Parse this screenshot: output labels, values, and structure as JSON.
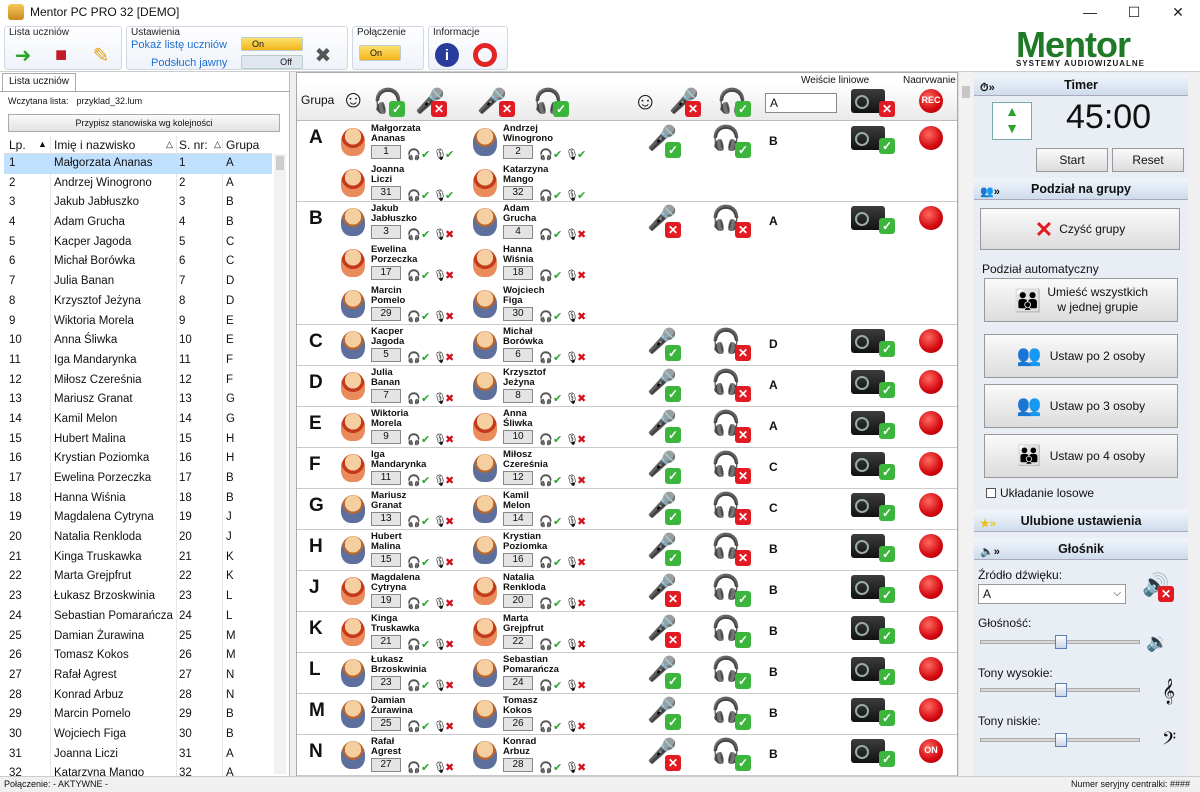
{
  "window": {
    "title": "Mentor PC PRO 32 [DEMO]"
  },
  "ribbon": {
    "group1_label": "Lista uczniów",
    "group2_label": "Ustawienia",
    "show_list_label": "Pokaż listę uczniów",
    "show_list_state": "On",
    "listen_label": "Podsłuch jawny",
    "listen_state": "Off",
    "group3_label": "Połączenie",
    "conn_state": "On",
    "group4_label": "Informacje",
    "logo_text": "Mentor",
    "logo_sub": "SYSTEMY AUDIOWIZUALNE"
  },
  "left": {
    "tab": "Lista uczniów",
    "loaded_label": "Wczytana lista:",
    "loaded_file": "przyklad_32.lum",
    "sort_button": "Przypisz stanowiska wg kolejności",
    "headers": [
      "Lp.",
      "Imię i nazwisko",
      "S. nr:",
      "Grupa"
    ],
    "rows": [
      [
        "1",
        "Małgorzata Ananas",
        "1",
        "A"
      ],
      [
        "2",
        "Andrzej Winogrono",
        "2",
        "A"
      ],
      [
        "3",
        "Jakub Jabłuszko",
        "3",
        "B"
      ],
      [
        "4",
        "Adam Grucha",
        "4",
        "B"
      ],
      [
        "5",
        "Kacper Jagoda",
        "5",
        "C"
      ],
      [
        "6",
        "Michał Borówka",
        "6",
        "C"
      ],
      [
        "7",
        "Julia Banan",
        "7",
        "D"
      ],
      [
        "8",
        "Krzysztof Jeżyna",
        "8",
        "D"
      ],
      [
        "9",
        "Wiktoria Morela",
        "9",
        "E"
      ],
      [
        "10",
        "Anna Śliwka",
        "10",
        "E"
      ],
      [
        "11",
        "Iga Mandarynka",
        "11",
        "F"
      ],
      [
        "12",
        "Miłosz Czereśnia",
        "12",
        "F"
      ],
      [
        "13",
        "Mariusz Granat",
        "13",
        "G"
      ],
      [
        "14",
        "Kamil Melon",
        "14",
        "G"
      ],
      [
        "15",
        "Hubert Malina",
        "15",
        "H"
      ],
      [
        "16",
        "Krystian Poziomka",
        "16",
        "H"
      ],
      [
        "17",
        "Ewelina Porzeczka",
        "17",
        "B"
      ],
      [
        "18",
        "Hanna Wiśnia",
        "18",
        "B"
      ],
      [
        "19",
        "Magdalena Cytryna",
        "19",
        "J"
      ],
      [
        "20",
        "Natalia Renkloda",
        "20",
        "J"
      ],
      [
        "21",
        "Kinga Truskawka",
        "21",
        "K"
      ],
      [
        "22",
        "Marta Grejpfrut",
        "22",
        "K"
      ],
      [
        "23",
        "Łukasz Brzoskwinia",
        "23",
        "L"
      ],
      [
        "24",
        "Sebastian Pomarańcza",
        "24",
        "L"
      ],
      [
        "25",
        "Damian Żurawina",
        "25",
        "M"
      ],
      [
        "26",
        "Tomasz Kokos",
        "26",
        "M"
      ],
      [
        "27",
        "Rafał Agrest",
        "27",
        "N"
      ],
      [
        "28",
        "Konrad Arbuz",
        "28",
        "N"
      ],
      [
        "29",
        "Marcin Pomelo",
        "29",
        "B"
      ],
      [
        "30",
        "Wojciech Figa",
        "30",
        "B"
      ],
      [
        "31",
        "Joanna Liczi",
        "31",
        "A"
      ],
      [
        "32",
        "Katarzyna Mango",
        "32",
        "A"
      ]
    ]
  },
  "center": {
    "group_label": "Grupa",
    "line_in_label": "Wejście liniowe",
    "recording_label": "Nagrywanie",
    "header_source": "A",
    "header_rec": "REC",
    "groups": [
      {
        "letter": "A",
        "src": "B",
        "rec": "",
        "students": [
          [
            "Małgorzata",
            "Ananas",
            "1",
            "girl"
          ],
          [
            "Andrzej",
            "Winogrono",
            "2",
            "boy"
          ],
          [
            "Joanna",
            "Liczi",
            "31",
            "girl"
          ],
          [
            "Katarzyna",
            "Mango",
            "32",
            "girl"
          ]
        ]
      },
      {
        "letter": "B",
        "src": "A",
        "rec": "",
        "students": [
          [
            "Jakub",
            "Jabłuszko",
            "3",
            "boy"
          ],
          [
            "Adam",
            "Grucha",
            "4",
            "boy"
          ],
          [
            "Ewelina",
            "Porzeczka",
            "17",
            "girl"
          ],
          [
            "Hanna",
            "Wiśnia",
            "18",
            "girl"
          ],
          [
            "Marcin",
            "Pomelo",
            "29",
            "boy"
          ],
          [
            "Wojciech",
            "Figa",
            "30",
            "boy"
          ]
        ]
      },
      {
        "letter": "C",
        "src": "D",
        "rec": "",
        "students": [
          [
            "Kacper",
            "Jagoda",
            "5",
            "boy"
          ],
          [
            "Michał",
            "Borówka",
            "6",
            "boy"
          ]
        ]
      },
      {
        "letter": "D",
        "src": "A",
        "rec": "",
        "students": [
          [
            "Julia",
            "Banan",
            "7",
            "girl"
          ],
          [
            "Krzysztof",
            "Jeżyna",
            "8",
            "boy"
          ]
        ]
      },
      {
        "letter": "E",
        "src": "A",
        "rec": "",
        "students": [
          [
            "Wiktoria",
            "Morela",
            "9",
            "girl"
          ],
          [
            "Anna",
            "Śliwka",
            "10",
            "girl"
          ]
        ]
      },
      {
        "letter": "F",
        "src": "C",
        "rec": "",
        "students": [
          [
            "Iga",
            "Mandarynka",
            "11",
            "girl"
          ],
          [
            "Miłosz",
            "Czereśnia",
            "12",
            "boy"
          ]
        ]
      },
      {
        "letter": "G",
        "src": "C",
        "rec": "",
        "students": [
          [
            "Mariusz",
            "Granat",
            "13",
            "boy"
          ],
          [
            "Kamil",
            "Melon",
            "14",
            "boy"
          ]
        ]
      },
      {
        "letter": "H",
        "src": "B",
        "rec": "",
        "students": [
          [
            "Hubert",
            "Malina",
            "15",
            "boy"
          ],
          [
            "Krystian",
            "Poziomka",
            "16",
            "boy"
          ]
        ]
      },
      {
        "letter": "J",
        "src": "B",
        "rec": "",
        "students": [
          [
            "Magdalena",
            "Cytryna",
            "19",
            "girl"
          ],
          [
            "Natalia",
            "Renkloda",
            "20",
            "girl"
          ]
        ]
      },
      {
        "letter": "K",
        "src": "B",
        "rec": "",
        "students": [
          [
            "Kinga",
            "Truskawka",
            "21",
            "girl"
          ],
          [
            "Marta",
            "Grejpfrut",
            "22",
            "girl"
          ]
        ]
      },
      {
        "letter": "L",
        "src": "B",
        "rec": "",
        "students": [
          [
            "Łukasz",
            "Brzoskwinia",
            "23",
            "boy"
          ],
          [
            "Sebastian",
            "Pomarańcza",
            "24",
            "boy"
          ]
        ]
      },
      {
        "letter": "M",
        "src": "B",
        "rec": "",
        "students": [
          [
            "Damian",
            "Żurawina",
            "25",
            "boy"
          ],
          [
            "Tomasz",
            "Kokos",
            "26",
            "boy"
          ]
        ]
      },
      {
        "letter": "N",
        "src": "B",
        "rec": "ON",
        "students": [
          [
            "Rafał",
            "Agrest",
            "27",
            "boy"
          ],
          [
            "Konrad",
            "Arbuz",
            "28",
            "boy"
          ]
        ]
      }
    ]
  },
  "right": {
    "timer_title": "Timer",
    "timer_value": "45:00",
    "start": "Start",
    "reset": "Reset",
    "groups_title": "Podział na grupy",
    "clear_groups": "Czyść grupy",
    "auto_label": "Podział automatyczny",
    "all_one_1": "Umieść wszystkich",
    "all_one_2": "w jednej grupie",
    "by2": "Ustaw po 2 osoby",
    "by3": "Ustaw po 3 osoby",
    "by4": "Ustaw po 4 osoby",
    "random": "Układanie losowe",
    "fav_title": "Ulubione ustawienia",
    "speaker_title": "Głośnik",
    "sound_src_label": "Źródło dźwięku:",
    "sound_src_value": "A",
    "volume_label": "Głośność:",
    "treble_label": "Tony wysokie:",
    "bass_label": "Tony niskie:"
  },
  "status": {
    "left": "Połączenie: - AKTYWNE -",
    "right": "Numer seryjny centralki: ####"
  },
  "colors": {
    "accent": "#1e7a26",
    "selection": "#bfe0ff",
    "ok": "#3bb53b",
    "error": "#e21b23"
  },
  "icons": {
    "headphones": "headphones-icon",
    "microphone": "microphone-icon",
    "recorder": "recorder-icon",
    "record": "record-icon"
  }
}
